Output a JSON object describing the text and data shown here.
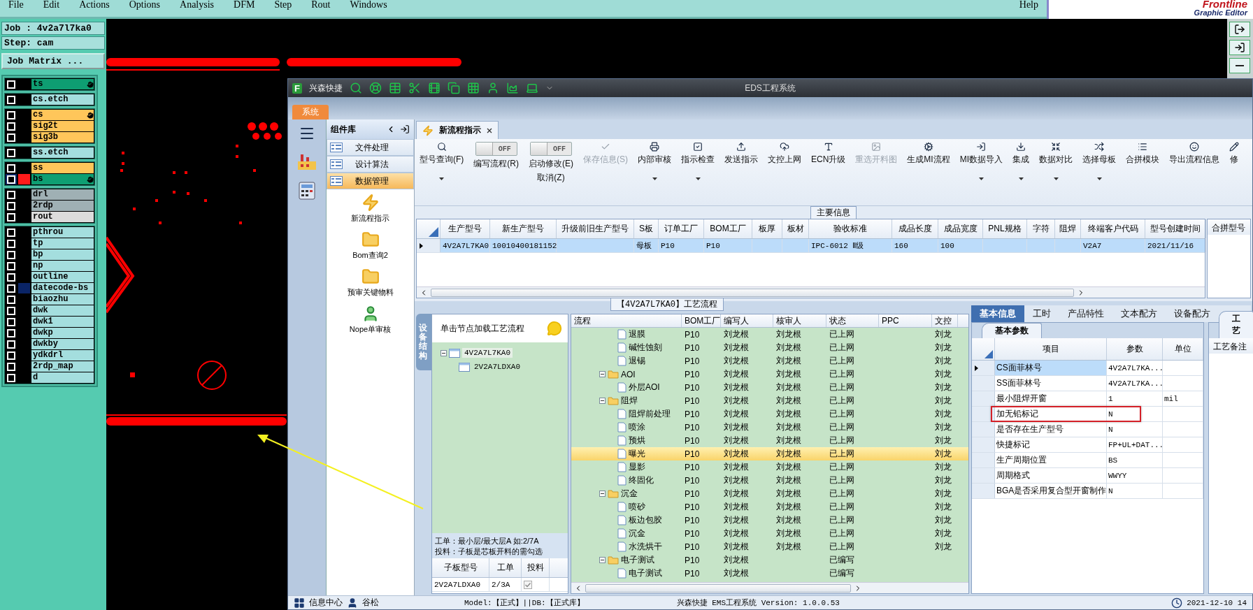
{
  "menu_bar": {
    "items": [
      "File",
      "Edit",
      "Actions",
      "Options",
      "Analysis",
      "DFM",
      "Step",
      "Rout",
      "Windows"
    ],
    "help": "Help"
  },
  "logo": {
    "brand": "Frontline",
    "subtitle": "Graphic Editor"
  },
  "job_panel": {
    "job": "Job : 4v2a7l7ka0",
    "step": "Step: cam",
    "matrix_button": "Job Matrix ..."
  },
  "layer_groups": [
    {
      "layers": [
        {
          "name": "ts",
          "color": "#0e9e72",
          "marked": true,
          "selected": false
        }
      ]
    },
    {
      "layers": [
        {
          "name": "cs.etch",
          "color": "#a4dede",
          "marked": false,
          "selected": false
        }
      ]
    },
    {
      "layers": [
        {
          "name": "cs",
          "color": "#ffc65a",
          "marked": true,
          "selected": false
        },
        {
          "name": "sig2t",
          "color": "#ffc65a",
          "marked": false,
          "selected": false
        },
        {
          "name": "sig3b",
          "color": "#ffc65a",
          "marked": false,
          "selected": false
        }
      ]
    },
    {
      "layers": [
        {
          "name": "ss.etch",
          "color": "#a4dede",
          "marked": false,
          "selected": false
        }
      ]
    },
    {
      "layers": [
        {
          "name": "ss",
          "color": "#ffc65a",
          "marked": false,
          "selected": false
        },
        {
          "name": "bs",
          "color": "#0e9e72",
          "marked": true,
          "selected": true,
          "swatch": {
            "color": "#ff1a1a"
          }
        }
      ]
    },
    {
      "layers": [
        {
          "name": "drl",
          "color": "#9fb0b4",
          "marked": false,
          "selected": false
        },
        {
          "name": "2rdp",
          "color": "#9fb0b4",
          "marked": false,
          "selected": false
        },
        {
          "name": "rout",
          "color": "#dcdcdc",
          "marked": false,
          "selected": false
        }
      ]
    },
    {
      "layers": [
        {
          "name": "pthrou",
          "color": "#a4dede",
          "marked": false,
          "selected": false
        },
        {
          "name": "tp",
          "color": "#a4dede",
          "marked": false,
          "selected": false
        },
        {
          "name": "bp",
          "color": "#a4dede",
          "marked": false,
          "selected": false
        },
        {
          "name": "np",
          "color": "#a4dede",
          "marked": false,
          "selected": false
        },
        {
          "name": "outline",
          "color": "#a4dede",
          "marked": false,
          "selected": false
        },
        {
          "name": "datecode-bs",
          "color": "#a4dede",
          "marked": false,
          "selected": false,
          "swatch": {
            "color": "#0a2466"
          }
        },
        {
          "name": "biaozhu",
          "color": "#a4dede",
          "marked": false,
          "selected": false
        },
        {
          "name": "dwk",
          "color": "#a4dede",
          "marked": false,
          "selected": false
        },
        {
          "name": "dwk1",
          "color": "#a4dede",
          "marked": false,
          "selected": false
        },
        {
          "name": "dwkp",
          "color": "#a4dede",
          "marked": false,
          "selected": false
        },
        {
          "name": "dwkby",
          "color": "#a4dede",
          "marked": false,
          "selected": false
        },
        {
          "name": "ydkdrl",
          "color": "#a4dede",
          "marked": false,
          "selected": false
        },
        {
          "name": "2rdp_map",
          "color": "#a4dede",
          "marked": false,
          "selected": false
        },
        {
          "name": "d",
          "color": "#a4dede",
          "marked": false,
          "selected": false
        }
      ]
    }
  ],
  "app": {
    "logo": "F",
    "name": "兴森快捷",
    "title": "EDS工程系统",
    "system_tab": "系统",
    "library": {
      "title": "组件库",
      "categories": [
        {
          "label": "文件处理",
          "selected": false
        },
        {
          "label": "设计算法",
          "selected": false
        },
        {
          "label": "数据管理",
          "selected": true
        }
      ],
      "modules": [
        {
          "kind": "bolt",
          "label": "新流程指示"
        },
        {
          "kind": "folder",
          "label": "Bom查询2"
        },
        {
          "kind": "folder",
          "label": "预审关键物料"
        },
        {
          "kind": "person",
          "label": "Nope单审核"
        }
      ]
    },
    "document_tab": "新流程指示",
    "toolbar": [
      {
        "kind": "button",
        "label": "型号查询(F)",
        "dropdown": true,
        "disabled": false
      },
      {
        "kind": "toggle",
        "label": "编写流程(R)",
        "switch_text": "OFF",
        "on": false
      },
      {
        "kind": "toggle",
        "label": "启动修改(E)",
        "sub_label": "取消(Z)",
        "switch_text": "OFF",
        "on": false
      },
      {
        "kind": "button",
        "label": "保存信息(S)",
        "dropdown": false,
        "disabled": true
      },
      {
        "kind": "button",
        "label": "内部审核",
        "dropdown": true,
        "disabled": false
      },
      {
        "kind": "button",
        "label": "指示检查",
        "dropdown": true,
        "disabled": false
      },
      {
        "kind": "button",
        "label": "发送指示",
        "dropdown": false,
        "disabled": false
      },
      {
        "kind": "button",
        "label": "文控上网",
        "dropdown": false,
        "disabled": false
      },
      {
        "kind": "button",
        "label": "ECN升级",
        "dropdown": false,
        "disabled": false
      },
      {
        "kind": "button",
        "label": "重选开料图",
        "dropdown": false,
        "disabled": true
      },
      {
        "kind": "button",
        "label": "生成MI流程",
        "dropdown": false,
        "disabled": false
      },
      {
        "kind": "button",
        "label": "MI数据导入",
        "dropdown": true,
        "disabled": false
      },
      {
        "kind": "button",
        "label": "集成",
        "dropdown": true,
        "disabled": false
      },
      {
        "kind": "button",
        "label": "数据对比",
        "dropdown": true,
        "disabled": false
      },
      {
        "kind": "button",
        "label": "选择母板",
        "dropdown": true,
        "disabled": false
      },
      {
        "kind": "button",
        "label": "合拼模块",
        "dropdown": false,
        "disabled": false
      },
      {
        "kind": "button",
        "label": "导出流程信息",
        "dropdown": false,
        "disabled": false
      },
      {
        "kind": "button",
        "label": "修",
        "dropdown": false,
        "disabled": false
      }
    ],
    "main_info": {
      "title": "主要信息",
      "columns": [
        "生产型号",
        "新生产型号",
        "升级前旧生产型号",
        "S板",
        "订单工厂",
        "BOM工厂",
        "板厚",
        "板材",
        "验收标准",
        "成品长度",
        "成品宽度",
        "PNL规格",
        "字符",
        "阻焊",
        "终端客户代码",
        "型号创建时间"
      ],
      "rows": [
        {
          "selected": true,
          "cells": [
            "4V2A7L7KA0",
            "10010400181152",
            null,
            "母板",
            "P10",
            "P10",
            null,
            null,
            "IPC-6012 Ⅱ级",
            "160",
            "100",
            null,
            null,
            null,
            "V2A7",
            "2021/11/16"
          ]
        }
      ],
      "side_title": "合拼型号"
    },
    "process": {
      "title": "【4V2A7L7KA0】工艺流程",
      "side_tab": "设备结构",
      "hint": "单击节点加载工艺流程",
      "tree": [
        {
          "label": "4V2A7L7KA0",
          "expanded": true,
          "selected": true,
          "children": [
            {
              "label": "2V2A7LDXA0",
              "selected": false
            }
          ]
        }
      ],
      "notes": [
        "工单：最小层/最大层A 如:2/7A",
        "投料：子板是芯板开料的需勾选"
      ],
      "sub_table": {
        "columns": [
          "子板型号",
          "工单",
          "投料"
        ],
        "rows": [
          {
            "model": "2V2A7LDXA0",
            "order": "2/3A",
            "checked": true
          }
        ]
      }
    },
    "flow": {
      "columns": [
        "流程",
        "BOM工厂",
        "编写人",
        "核审人",
        "状态",
        "PPC",
        "文控"
      ],
      "rows": [
        {
          "kind": "continued",
          "children": [
            {
              "kind": "file",
              "name": "退膜",
              "bom": "P10",
              "writer": "刘龙根",
              "reviewer": "刘龙根",
              "status": "已上网",
              "doc": "刘龙",
              "selected": false
            },
            {
              "kind": "file",
              "name": "碱性蚀刻",
              "bom": "P10",
              "writer": "刘龙根",
              "reviewer": "刘龙根",
              "status": "已上网",
              "doc": "刘龙",
              "selected": false
            },
            {
              "kind": "file",
              "name": "退锡",
              "bom": "P10",
              "writer": "刘龙根",
              "reviewer": "刘龙根",
              "status": "已上网",
              "doc": "刘龙",
              "selected": false
            }
          ]
        },
        {
          "kind": "folder",
          "name": "AOI",
          "bom": "P10",
          "writer": "刘龙根",
          "reviewer": "刘龙根",
          "status": "已上网",
          "doc": "刘龙",
          "selected": false,
          "expanded": true,
          "children": [
            {
              "kind": "file",
              "name": "外层AOI",
              "bom": "P10",
              "writer": "刘龙根",
              "reviewer": "刘龙根",
              "status": "已上网",
              "doc": "刘龙",
              "selected": false
            }
          ]
        },
        {
          "kind": "folder",
          "name": "阻焊",
          "bom": "P10",
          "writer": "刘龙根",
          "reviewer": "刘龙根",
          "status": "已上网",
          "doc": "刘龙",
          "selected": false,
          "expanded": true,
          "children": [
            {
              "kind": "file",
              "name": "阻焊前处理",
              "bom": "P10",
              "writer": "刘龙根",
              "reviewer": "刘龙根",
              "status": "已上网",
              "doc": "刘龙",
              "selected": false
            },
            {
              "kind": "file",
              "name": "喷涂",
              "bom": "P10",
              "writer": "刘龙根",
              "reviewer": "刘龙根",
              "status": "已上网",
              "doc": "刘龙",
              "selected": false
            },
            {
              "kind": "file",
              "name": "预烘",
              "bom": "P10",
              "writer": "刘龙根",
              "reviewer": "刘龙根",
              "status": "已上网",
              "doc": "刘龙",
              "selected": false
            },
            {
              "kind": "file",
              "name": "曝光",
              "bom": "P10",
              "writer": "刘龙根",
              "reviewer": "刘龙根",
              "status": "已上网",
              "doc": "刘龙",
              "selected": true
            },
            {
              "kind": "file",
              "name": "显影",
              "bom": "P10",
              "writer": "刘龙根",
              "reviewer": "刘龙根",
              "status": "已上网",
              "doc": "刘龙",
              "selected": false
            },
            {
              "kind": "file",
              "name": "终固化",
              "bom": "P10",
              "writer": "刘龙根",
              "reviewer": "刘龙根",
              "status": "已上网",
              "doc": "刘龙",
              "selected": false
            }
          ]
        },
        {
          "kind": "folder",
          "name": "沉金",
          "bom": "P10",
          "writer": "刘龙根",
          "reviewer": "刘龙根",
          "status": "已上网",
          "doc": "刘龙",
          "selected": false,
          "expanded": true,
          "children": [
            {
              "kind": "file",
              "name": "喷砂",
              "bom": "P10",
              "writer": "刘龙根",
              "reviewer": "刘龙根",
              "status": "已上网",
              "doc": "刘龙",
              "selected": false
            },
            {
              "kind": "file",
              "name": "板边包胶",
              "bom": "P10",
              "writer": "刘龙根",
              "reviewer": "刘龙根",
              "status": "已上网",
              "doc": "刘龙",
              "selected": false
            },
            {
              "kind": "file",
              "name": "沉金",
              "bom": "P10",
              "writer": "刘龙根",
              "reviewer": "刘龙根",
              "status": "已上网",
              "doc": "刘龙",
              "selected": false
            },
            {
              "kind": "file",
              "name": "水洗烘干",
              "bom": "P10",
              "writer": "刘龙根",
              "reviewer": "刘龙根",
              "status": "已上网",
              "doc": "刘龙",
              "selected": false
            }
          ]
        },
        {
          "kind": "folder",
          "name": "电子测试",
          "bom": "P10",
          "writer": "刘龙根",
          "status": "已编写",
          "selected": false,
          "expanded": true,
          "children": [
            {
              "kind": "file",
              "name": "电子测试",
              "bom": "P10",
              "writer": "刘龙根",
              "status": "已编写",
              "selected": false
            }
          ]
        }
      ]
    },
    "details": {
      "tabs": [
        {
          "label": "基本信息",
          "selected": true
        },
        {
          "label": "工时",
          "selected": false
        },
        {
          "label": "产品特性",
          "selected": false
        },
        {
          "label": "文本配方",
          "selected": false
        },
        {
          "label": "设备配方",
          "selected": false
        }
      ],
      "subtab": "基本参数",
      "columns": [
        "项目",
        "参数",
        "单位"
      ],
      "rows": [
        {
          "item": "CS面菲林号",
          "value": "4V2A7L7KA...",
          "selected": true,
          "highlighted": false
        },
        {
          "item": "SS面菲林号",
          "value": "4V2A7L7KA...",
          "selected": false,
          "highlighted": false
        },
        {
          "item": "最小阻焊开窗",
          "value": "1",
          "unit": "mil",
          "selected": false,
          "highlighted": false
        },
        {
          "item": "加无铅标记",
          "value": "N",
          "selected": false,
          "highlighted": true
        },
        {
          "item": "是否存在生产型号",
          "value": "N",
          "selected": false,
          "highlighted": false
        },
        {
          "item": "快捷标记",
          "value": "FP+UL+DAT...",
          "selected": false,
          "highlighted": false
        },
        {
          "item": "生产周期位置",
          "value": "BS",
          "selected": false,
          "highlighted": false
        },
        {
          "item": "周期格式",
          "value": "WWYY",
          "selected": false,
          "highlighted": false
        },
        {
          "item": "BGA是否采用复合型开窗制作",
          "value": "N",
          "selected": false,
          "highlighted": false
        }
      ],
      "side_tab": "工艺",
      "side_label": "工艺备注"
    },
    "status_bar": {
      "info_center": "信息中心",
      "user": "谷松",
      "model": "Model:【正式】||DB:【正式库】",
      "version": "兴森快捷 EMS工程系统 Version: 1.0.0.53",
      "time": "2021-12-10 14"
    }
  }
}
